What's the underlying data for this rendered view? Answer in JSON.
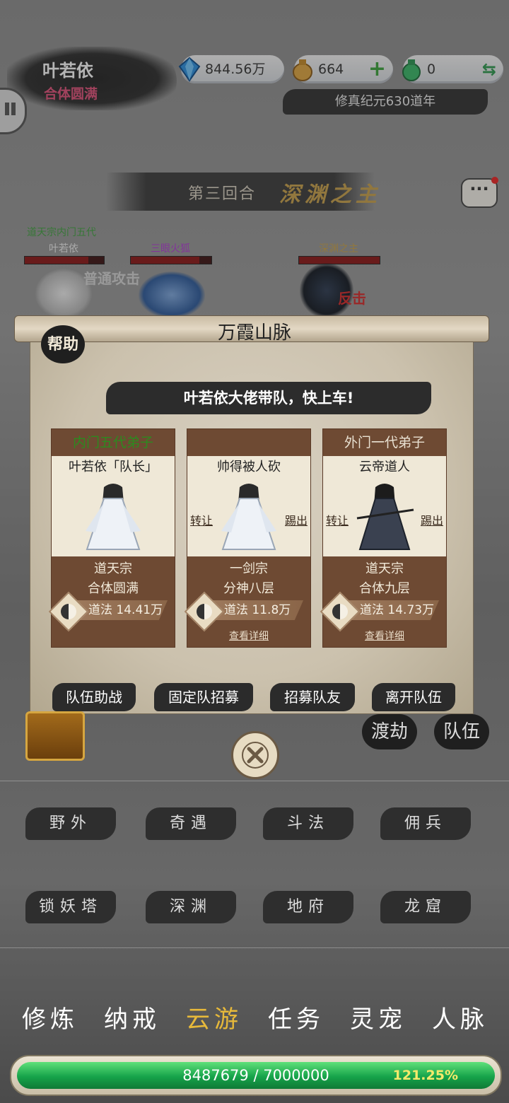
{
  "player": {
    "name": "叶若依",
    "rank": "合体圆满"
  },
  "resources": {
    "spirit_stones": "844.56万",
    "gold": "664",
    "jade": "0",
    "era": "修真纪元630道年"
  },
  "battle": {
    "round_label": "第三回合",
    "stage_name": "深渊之主",
    "ally_sect": "道天宗内门五代",
    "ally_name": "叶若依",
    "pet_name": "三眼火狐",
    "enemy_name": "深渊之主",
    "attack_text": "普通攻击",
    "counter_text": "反击",
    "ally_hp": 0.8,
    "pet_hp": 0.85,
    "enemy_hp": 1.0
  },
  "panel": {
    "title": "万霞山脉",
    "help_label": "帮助",
    "banner": "叶若依大佬带队，快上车!",
    "members": [
      {
        "rank_tag": "内门五代弟子",
        "name": "叶若依「队长」",
        "sect": "道天宗",
        "level": "合体圆满",
        "dao": "道法 14.41万"
      },
      {
        "rank_tag": "",
        "name": "帅得被人砍",
        "sect": "一剑宗",
        "level": "分神八层",
        "dao": "道法 11.8万",
        "transfer": "转让",
        "kick": "踢出",
        "detail": "查看详细"
      },
      {
        "rank_tag": "外门一代弟子",
        "name": "云帝道人",
        "sect": "道天宗",
        "level": "合体九层",
        "dao": "道法 14.73万",
        "transfer": "转让",
        "kick": "踢出",
        "detail": "查看详细"
      }
    ],
    "buttons": [
      "队伍助战",
      "固定队招募",
      "招募队友",
      "离开队伍"
    ]
  },
  "side_buttons": {
    "tribulation": "渡劫",
    "team": "队伍"
  },
  "locations": [
    "野外",
    "奇遇",
    "斗法",
    "佣兵",
    "锁妖塔",
    "深渊",
    "地府",
    "龙窟"
  ],
  "nav": {
    "items": [
      "修炼",
      "纳戒",
      "云游",
      "任务",
      "灵宠",
      "人脉"
    ],
    "active": "云游"
  },
  "exp": {
    "text": "8487679 / 7000000",
    "percent": "121.25%"
  }
}
